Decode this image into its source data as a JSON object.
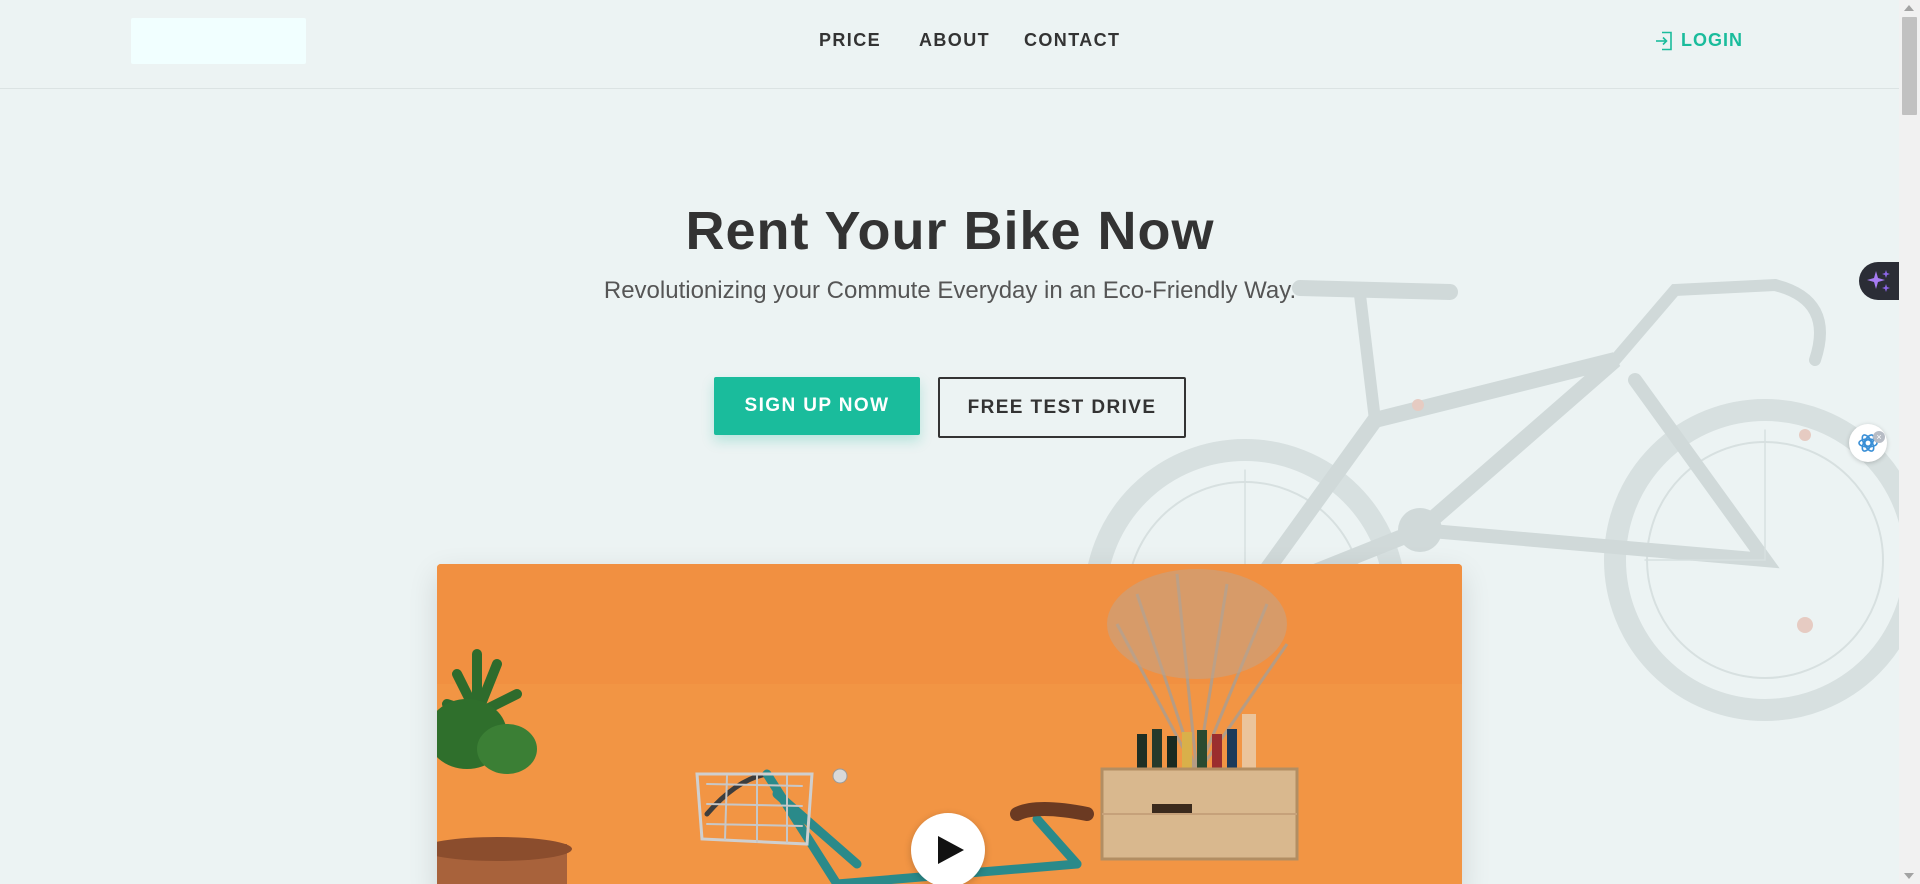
{
  "header": {
    "nav": [
      {
        "label": "PRICE"
      },
      {
        "label": "ABOUT"
      },
      {
        "label": "CONTACT"
      }
    ],
    "login_label": "LOGIN"
  },
  "hero": {
    "title": "Rent Your Bike Now",
    "subtitle": "Revolutionizing your Commute Everyday in an Eco-Friendly Way.",
    "primary_button": "SIGN UP NOW",
    "secondary_button": "FREE TEST DRIVE"
  },
  "video": {
    "play_icon": "play-icon"
  },
  "colors": {
    "accent": "#1abc9c",
    "background": "#ecf3f3",
    "text": "#333333",
    "video_background": "#f0933f"
  },
  "floating": {
    "ai_icon": "sparkle-icon",
    "assistant_icon": "chatgpt-icon",
    "close_glyph": "×"
  }
}
